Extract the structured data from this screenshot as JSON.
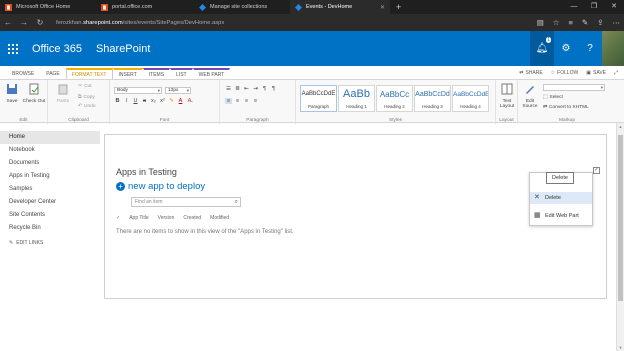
{
  "browser": {
    "tabs": [
      {
        "label": "Microsoft Office Home",
        "active": false,
        "icon": "office-icon"
      },
      {
        "label": "portal.office.com",
        "active": false,
        "icon": "office-icon"
      },
      {
        "label": "Manage site collections",
        "active": false,
        "icon": "sharepoint-icon"
      },
      {
        "label": "Events - DevHome",
        "active": true,
        "icon": "sharepoint-icon"
      }
    ],
    "url_prefix": "ferozkhan.",
    "url_domain": "sharepoint.com",
    "url_path": "/sites/events/SitePages/DevHome.aspx"
  },
  "suite": {
    "brand": "Office 365",
    "app": "SharePoint",
    "notification_count": "1"
  },
  "ribbon_tabs": [
    "BROWSE",
    "PAGE",
    "FORMAT TEXT",
    "INSERT",
    "ITEMS",
    "LIST",
    "WEB PART"
  ],
  "ribbon_actions": {
    "share": "SHARE",
    "follow": "FOLLOW",
    "save": "SAVE"
  },
  "ribbon": {
    "edit": {
      "save": "Save",
      "checkout": "Check Out",
      "group": "Edit"
    },
    "clipboard": {
      "paste": "Paste",
      "cut": "Cut",
      "copy": "Copy",
      "undo": "Undo",
      "group": "Clipboard"
    },
    "font": {
      "family": "Body",
      "size": "13px",
      "group": "Font"
    },
    "paragraph": {
      "group": "Paragraph"
    },
    "styles": {
      "items": [
        {
          "preview": "AaBbCcDdE",
          "name": "Paragraph"
        },
        {
          "preview": "AaBb",
          "name": "Heading 1"
        },
        {
          "preview": "AaBbCc",
          "name": "Heading 2"
        },
        {
          "preview": "AaBbCcDd",
          "name": "Heading 3"
        },
        {
          "preview": "AaBbCcDdE",
          "name": "Heading 4"
        }
      ],
      "group": "Styles"
    },
    "layout": {
      "text_layout": "Text Layout",
      "group": "Layout"
    },
    "markup": {
      "edit_source": "Edit Source",
      "select": "Select",
      "convert": "Convert to XHTML",
      "group": "Markup"
    }
  },
  "leftnav": {
    "items": [
      "Home",
      "Notebook",
      "Documents",
      "Apps in Testing",
      "Samples",
      "Developer Center",
      "Site Contents",
      "Recycle Bin"
    ],
    "edit_links": "EDIT LINKS"
  },
  "webpart": {
    "title": "Apps in Testing",
    "new_app": "new app to deploy",
    "find_placeholder": "Find an item",
    "columns": [
      "App Title",
      "Version",
      "Created",
      "Modified"
    ],
    "empty_message": "There are no items to show in this view of the \"Apps in Testing\" list."
  },
  "menu": {
    "tooltip": "Delete",
    "items": [
      {
        "label": "Delete",
        "icon": "x-icon"
      },
      {
        "label": "Edit Web Part",
        "icon": "edit-webpart-icon"
      }
    ]
  }
}
